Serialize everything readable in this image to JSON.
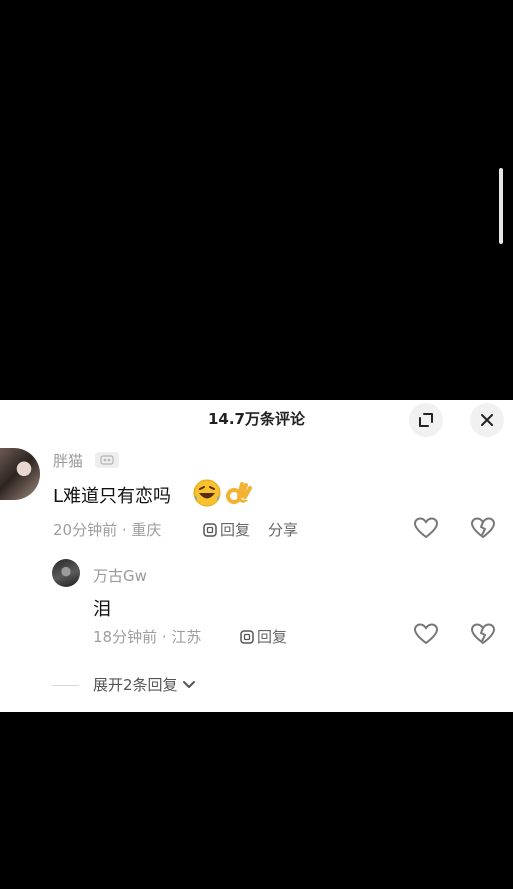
{
  "header": {
    "title": "14.7万条评论"
  },
  "comments": [
    {
      "username": "胖猫",
      "badge_icon": "fan-badge-icon",
      "text": "L难道只有恋吗",
      "emojis": [
        "rofl-emoji-icon",
        "ok-hand-emoji-icon"
      ],
      "meta": "20分钟前 · 重庆",
      "reply_label": "回复",
      "share_label": "分享"
    },
    {
      "username": "万古Gw",
      "text": "泪",
      "meta": "18分钟前 · 江苏",
      "reply_label": "回复"
    }
  ],
  "expand_replies_label": "展开2条回复",
  "colors": {
    "panel_bg": "#ffffff",
    "page_bg": "#000000",
    "meta_text": "#9e9e9e"
  }
}
